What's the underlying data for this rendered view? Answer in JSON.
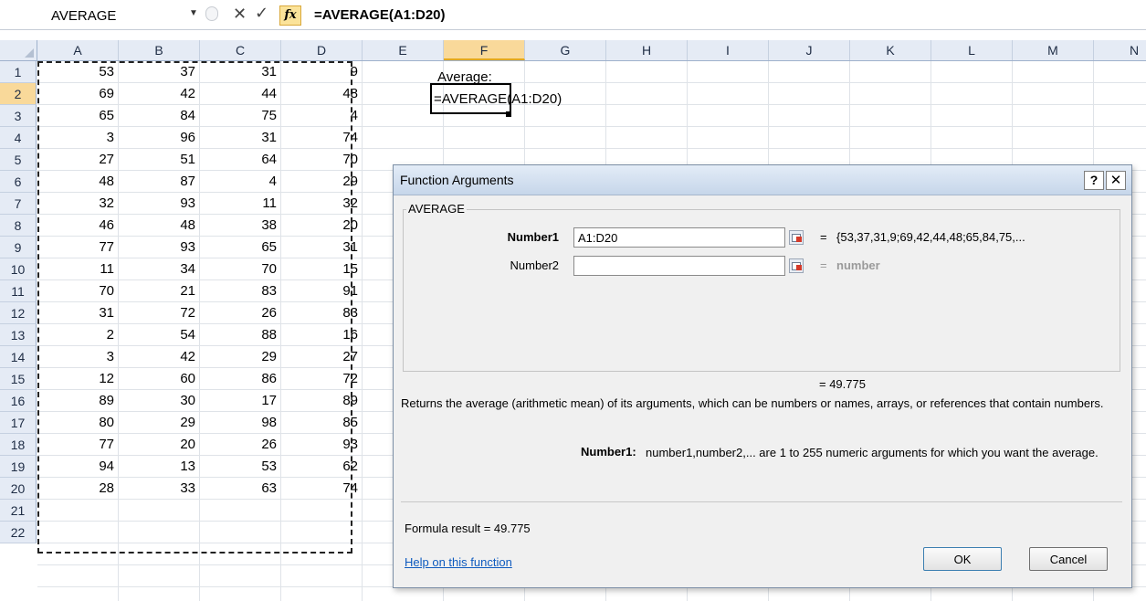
{
  "formula_bar": {
    "name_box": "AVERAGE",
    "cancel_glyph": "✕",
    "enter_glyph": "✓",
    "fx_label": "fx",
    "formula": "=AVERAGE(A1:D20)"
  },
  "columns": [
    "A",
    "B",
    "C",
    "D",
    "E",
    "F",
    "G",
    "H",
    "I",
    "J",
    "K",
    "L",
    "M",
    "N"
  ],
  "active_column": "F",
  "active_row": "2",
  "rows": [
    "1",
    "2",
    "3",
    "4",
    "5",
    "6",
    "7",
    "8",
    "9",
    "10",
    "11",
    "12",
    "13",
    "14",
    "15",
    "16",
    "17",
    "18",
    "19",
    "20",
    "21",
    "22"
  ],
  "data_rows": [
    [
      "53",
      "37",
      "31",
      "9"
    ],
    [
      "69",
      "42",
      "44",
      "48"
    ],
    [
      "65",
      "84",
      "75",
      "4"
    ],
    [
      "3",
      "96",
      "31",
      "74"
    ],
    [
      "27",
      "51",
      "64",
      "70"
    ],
    [
      "48",
      "87",
      "4",
      "29"
    ],
    [
      "32",
      "93",
      "11",
      "32"
    ],
    [
      "46",
      "48",
      "38",
      "20"
    ],
    [
      "77",
      "93",
      "65",
      "31"
    ],
    [
      "11",
      "34",
      "70",
      "15"
    ],
    [
      "70",
      "21",
      "83",
      "91"
    ],
    [
      "31",
      "72",
      "26",
      "83"
    ],
    [
      "2",
      "54",
      "88",
      "16"
    ],
    [
      "3",
      "42",
      "29",
      "27"
    ],
    [
      "12",
      "60",
      "86",
      "72"
    ],
    [
      "89",
      "30",
      "17",
      "89"
    ],
    [
      "80",
      "29",
      "98",
      "85"
    ],
    [
      "77",
      "20",
      "26",
      "93"
    ],
    [
      "94",
      "13",
      "53",
      "62"
    ],
    [
      "28",
      "33",
      "63",
      "74"
    ]
  ],
  "cells": {
    "f1": "Average:",
    "f2": "=AVERAGE(A1:D20)"
  },
  "dialog": {
    "title": "Function Arguments",
    "help_glyph": "?",
    "close_glyph": "✕",
    "function_name": "AVERAGE",
    "number1_label": "Number1",
    "number1_value": "A1:D20",
    "number1_eq": "=",
    "number1_result": "{53,37,31,9;69,42,44,48;65,84,75,...",
    "number2_label": "Number2",
    "number2_value": "",
    "number2_eq": "=",
    "number2_result": "number",
    "result_preview": "=  49.775",
    "description": "Returns the average (arithmetic mean) of its arguments, which can be numbers or names, arrays, or references that contain numbers.",
    "arg_help_label": "Number1:",
    "arg_help_text": "number1,number2,... are 1 to 255 numeric arguments for which you want the average.",
    "formula_result": "Formula result =   49.775",
    "help_link": "Help on this function",
    "ok_label": "OK",
    "cancel_label": "Cancel"
  },
  "colors": {
    "header_bg": "#e5ebf5",
    "active_header": "#f9d99a",
    "link": "#0e5bbf"
  }
}
